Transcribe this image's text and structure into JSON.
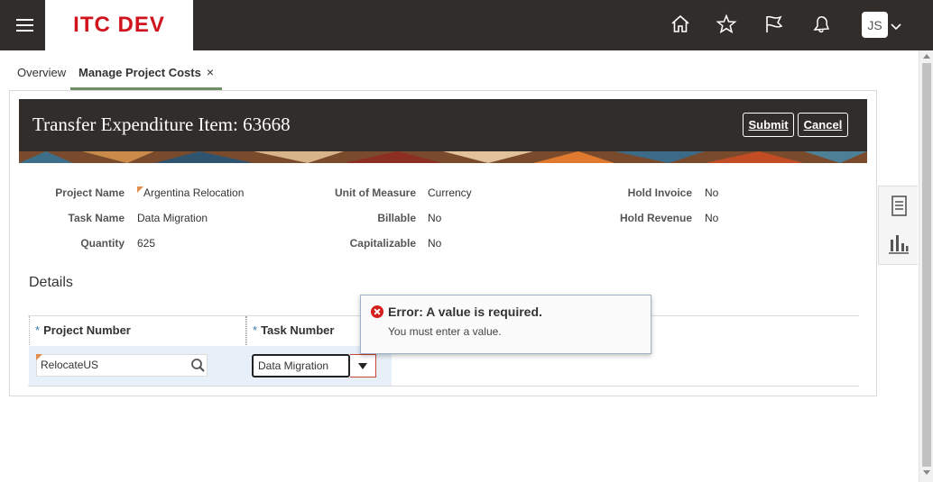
{
  "app": {
    "brand": "ITC DEV",
    "user_initials": "JS"
  },
  "top_icons": [
    "home-icon",
    "favorites-star-icon",
    "watchlist-flag-icon",
    "notifications-bell-icon"
  ],
  "tabs": [
    {
      "label": "Overview"
    },
    {
      "label": "Manage Project Costs",
      "close": "×"
    }
  ],
  "page": {
    "title": "Transfer Expenditure Item: 63668",
    "submit_label": "Submit",
    "cancel_label": "Cancel"
  },
  "summary": {
    "project_name_label": "Project Name",
    "project_name_value": "Argentina Relocation",
    "task_name_label": "Task Name",
    "task_name_value": "Data Migration",
    "quantity_label": "Quantity",
    "quantity_value": "625",
    "uom_label": "Unit of Measure",
    "uom_value": "Currency",
    "billable_label": "Billable",
    "billable_value": "No",
    "capitalizable_label": "Capitalizable",
    "capitalizable_value": "No",
    "hold_invoice_label": "Hold Invoice",
    "hold_invoice_value": "No",
    "hold_revenue_label": "Hold Revenue",
    "hold_revenue_value": "No"
  },
  "details": {
    "title": "Details",
    "required_mark": "*",
    "project_number_header": "Project Number",
    "task_number_header": "Task Number",
    "project_number_value": "RelocateUS",
    "task_number_value": "Data Migration"
  },
  "error": {
    "title": "Error: A value is required.",
    "message": "You must enter a value."
  },
  "colors": {
    "header_bg": "#312d2a",
    "brand_red": "#d0131d",
    "tab_underline": "#6d8f63",
    "error_red": "#d41f1f",
    "row_highlight": "#e7f0f9",
    "changed_marker": "#e28d4d"
  }
}
